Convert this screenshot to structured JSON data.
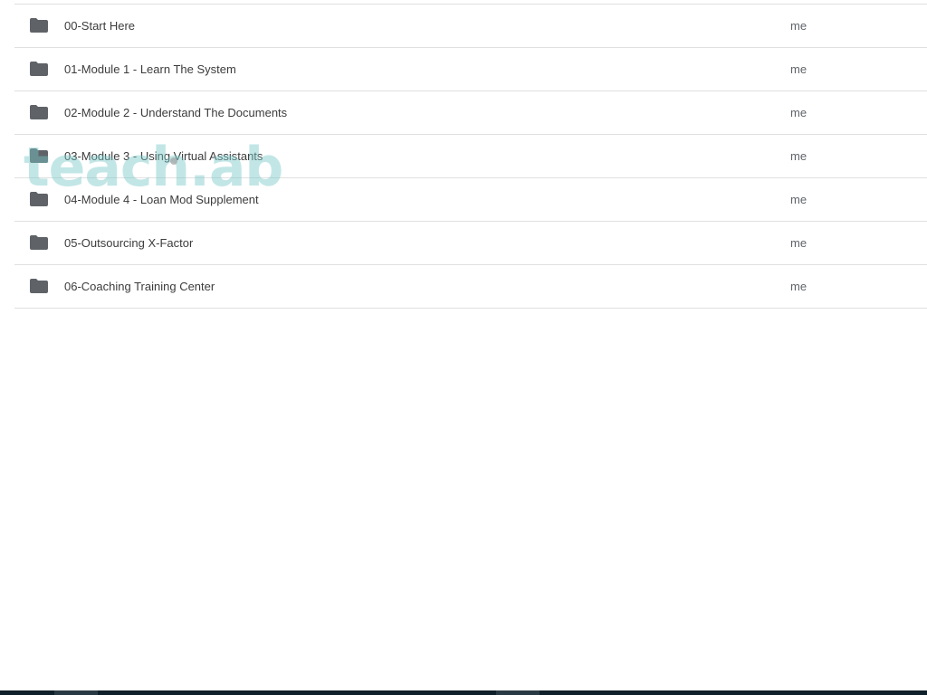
{
  "folders": [
    {
      "name": "00-Start Here",
      "owner": "me"
    },
    {
      "name": "01-Module 1 - Learn The System",
      "owner": "me"
    },
    {
      "name": "02-Module 2 - Understand The Documents",
      "owner": "me"
    },
    {
      "name": "03-Module 3 - Using Virtual Assistants",
      "owner": "me"
    },
    {
      "name": "04-Module 4 - Loan Mod Supplement",
      "owner": "me"
    },
    {
      "name": "05-Outsourcing X-Factor",
      "owner": "me"
    },
    {
      "name": "06-Coaching Training Center",
      "owner": "me"
    }
  ],
  "watermark": "teach.ab",
  "icons": {
    "folder": "folder-icon"
  },
  "colors": {
    "folder_icon": "#5f6368",
    "text": "#3c3c3c",
    "divider": "#e0e0e0",
    "watermark": "#78c8c8",
    "taskbar": "#10202a"
  }
}
